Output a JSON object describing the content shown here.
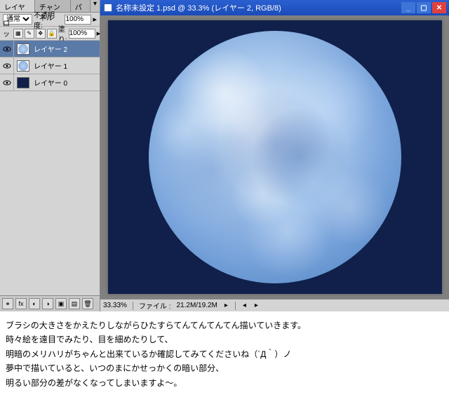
{
  "panel": {
    "tabs": {
      "layers": "レイヤー ×",
      "channels": "チャンネル",
      "paths": "パス"
    },
    "blend_mode": "通常",
    "opacity_label": "不透明度:",
    "opacity_value": "100%",
    "lock_label": "ロック:",
    "fill_label": "塗り:",
    "fill_value": "100%",
    "layers": [
      {
        "name": "レイヤー 2",
        "selected": true,
        "thumb": "moon"
      },
      {
        "name": "レイヤー 1",
        "selected": false,
        "thumb": "moon"
      },
      {
        "name": "レイヤー 0",
        "selected": false,
        "thumb": "dark"
      }
    ]
  },
  "window": {
    "title": "名称未設定 1.psd @ 33.3% (レイヤー 2, RGB/8)"
  },
  "status": {
    "zoom": "33.33%",
    "filesize_label": "ファイル :",
    "filesize": "21.2M/19.2M"
  },
  "tutorial": {
    "line1": "ブラシの大きさをかえたりしながらひたすらてんてんてんてん描いていきます。",
    "line2": "時々絵を遠目でみたり、目を細めたりして、",
    "line3": "明暗のメリハリがちゃんと出来ているか確認してみてくださいね（´Д｀）ノ",
    "line4": "夢中で描いていると、いつのまにかせっかくの暗い部分、",
    "line5": "明るい部分の差がなくなってしまいますよ～。"
  }
}
